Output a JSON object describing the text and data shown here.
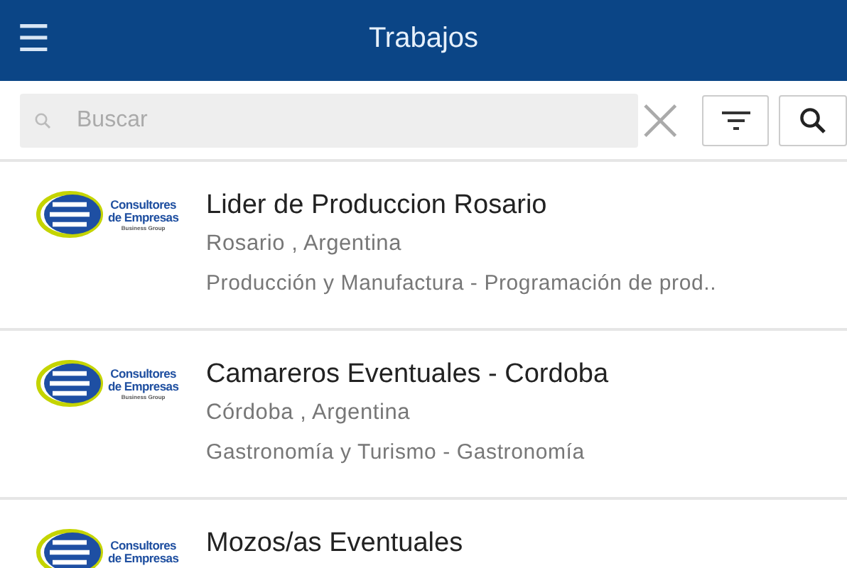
{
  "header": {
    "menu_icon": "☰",
    "title": "Trabajos"
  },
  "search": {
    "placeholder": "Buscar"
  },
  "jobs": [
    {
      "logo": {
        "lines": [
          "Consultores",
          "de Empresas",
          "Business Group"
        ]
      },
      "title": "Lider de Produccion Rosario",
      "location": "Rosario , Argentina",
      "category": "Producción y Manufactura - Programación de prod.."
    },
    {
      "logo": {
        "lines": [
          "Consultores",
          "de Empresas",
          "Business Group"
        ]
      },
      "title": "Camareros Eventuales - Cordoba",
      "location": "Córdoba , Argentina",
      "category": "Gastronomía y Turismo - Gastronomía"
    },
    {
      "logo": {
        "lines": [
          "Consultores",
          "de Empresas"
        ]
      },
      "title": "Mozos/as Eventuales"
    }
  ]
}
